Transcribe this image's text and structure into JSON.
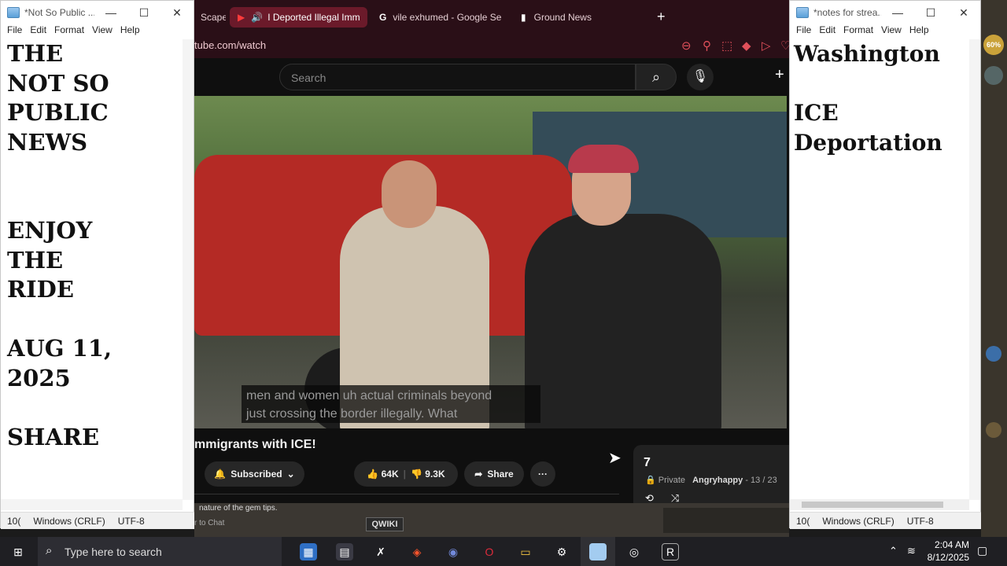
{
  "left_notepad": {
    "title": "*Not So Public ...",
    "menu": [
      "File",
      "Edit",
      "Format",
      "View",
      "Help"
    ],
    "content": "THE\nNOT SO\nPUBLIC\nNEWS\n\n\nENJOY\nTHE\nRIDE\n\nAUG 11,\n2025\n\nSHARE",
    "status": {
      "pos": "10(",
      "eol": "Windows (CRLF)",
      "enc": "UTF-8"
    }
  },
  "right_notepad": {
    "title": "*notes for strea...",
    "menu": [
      "File",
      "Edit",
      "Format",
      "View",
      "Help"
    ],
    "content": "Washington\n\nICE\nDeportation",
    "status": {
      "pos": "10(",
      "eol": "Windows (CRLF)",
      "enc": "UTF-8"
    }
  },
  "browser": {
    "tabs": [
      "Scape",
      "I Deported Illegal Imm",
      "vile exhumed - Google Se",
      "Ground News"
    ],
    "new_tab": "+",
    "address": "tube.com/watch",
    "search_placeholder": "Search",
    "create_icon": "+",
    "captions": [
      "men and women uh actual criminals beyond",
      "just crossing the border illegally. What"
    ],
    "video_title": "mmigrants with ICE!",
    "subscribed": "Subscribed",
    "likes": "64K",
    "dislikes": "9.3K",
    "share": "Share",
    "more": "···",
    "playlist": {
      "count": "7",
      "privacy": "Private",
      "owner": "Angryhappy",
      "position": "- 13 / 23"
    },
    "chat_snippet": "nature of the gem tips.",
    "chat_input": "r to Chat",
    "brand": "QWIKI"
  },
  "taskbar": {
    "search_placeholder": "Type here to search",
    "time": "2:04 AM",
    "date": "8/12/2025"
  },
  "overlay": {
    "zoom_badge": "60%"
  }
}
